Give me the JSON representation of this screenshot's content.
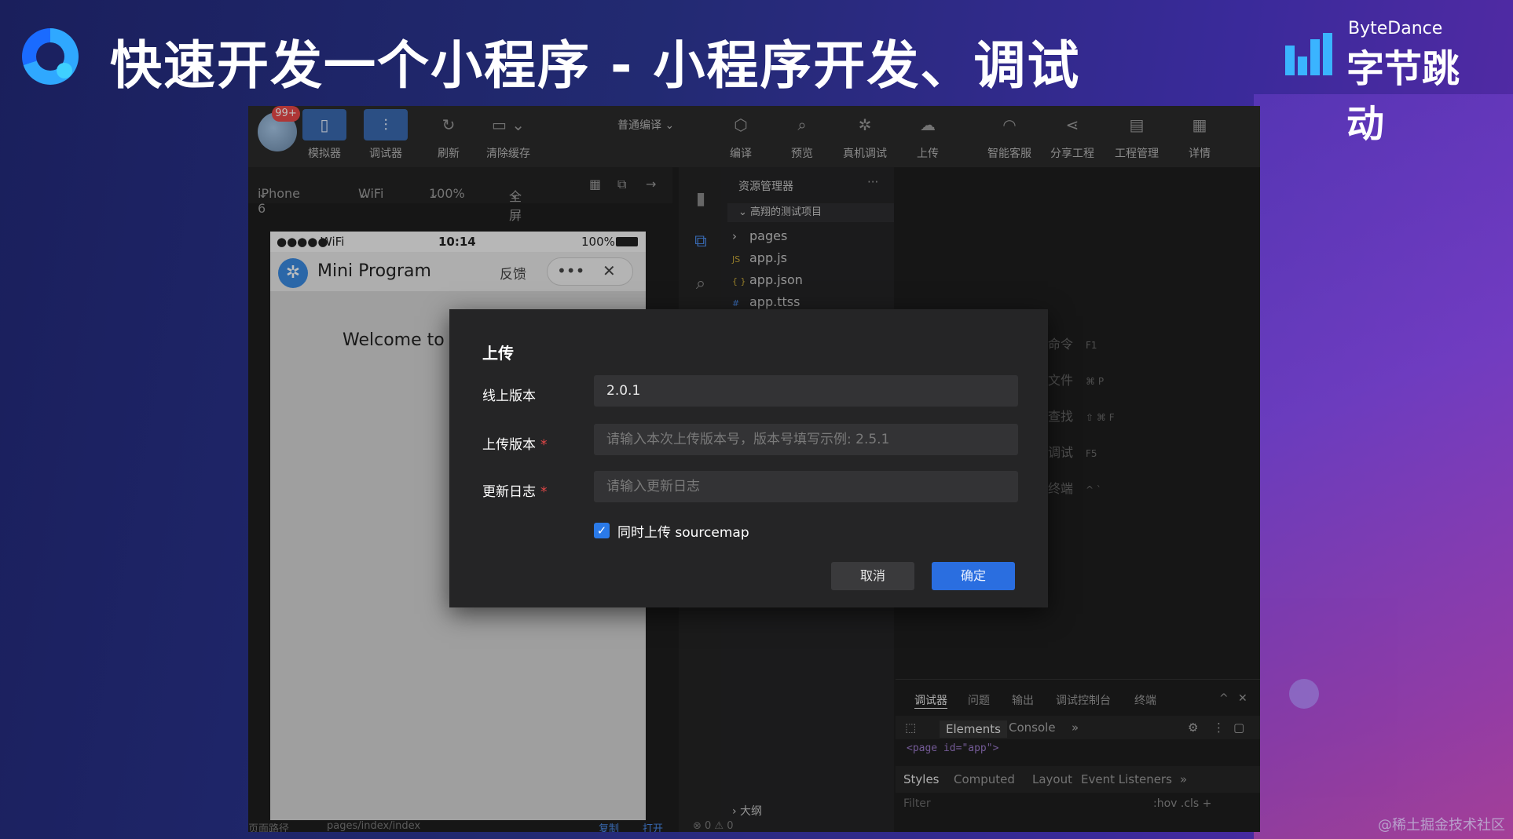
{
  "slide": {
    "title": "快速开发一个小程序 - 小程序开发、调试",
    "brand_en": "ByteDance",
    "brand_cn": "字节跳动",
    "watermark": "@稀土掘金技术社区"
  },
  "toolbar": {
    "badge": "99+",
    "simulator": "模拟器",
    "debugger": "调试器",
    "refresh": "刷新",
    "clear_cache": "清除缓存",
    "compile_mode": "普通编译",
    "compile": "编译",
    "preview": "预览",
    "device_debug": "真机调试",
    "upload": "上传",
    "support": "智能客服",
    "share": "分享工程",
    "project_mgmt": "工程管理",
    "details": "详情"
  },
  "devbar": {
    "device": "iPhone 6",
    "network": "WiFi",
    "zoom": "100%",
    "screen": "全屏"
  },
  "phone": {
    "signal": "●●●●●",
    "carrier": "WiFi",
    "time": "10:14",
    "battery": "100%",
    "app_title": "Mini Program",
    "feedback": "反馈",
    "more": "•••",
    "close": "✕",
    "welcome": "Welcome to"
  },
  "explorer": {
    "header": "资源管理器",
    "dots": "···",
    "project": "高翔的测试项目",
    "files": [
      {
        "icon": "›",
        "name": "pages"
      },
      {
        "icon": "JS",
        "name": "app.js"
      },
      {
        "icon": "{ }",
        "name": "app.json"
      },
      {
        "icon": "#",
        "name": "app.ttss"
      }
    ],
    "outline": "› 大纲"
  },
  "cmd_hints": [
    {
      "label": "命令",
      "keys": "F1"
    },
    {
      "label": "文件",
      "keys": "⌘  P"
    },
    {
      "label": "查找",
      "keys": "⇧  ⌘  F"
    },
    {
      "label": "调试",
      "keys": "F5"
    },
    {
      "label": "终端",
      "keys": "^  `"
    }
  ],
  "devtools": {
    "tabs": [
      "调试器",
      "问题",
      "输出",
      "调试控制台",
      "终端"
    ],
    "panel_tabs": [
      "Elements",
      "Console",
      "»"
    ],
    "code": "<page id=\"app\">",
    "style_tabs": [
      "Styles",
      "Computed",
      "Layout",
      "Event Listeners",
      "»"
    ],
    "filter": "Filter",
    "hov": ":hov  .cls  +"
  },
  "bottombar": {
    "path_label": "页面路径",
    "path": "pages/index/index",
    "copy": "复制",
    "open": "打开",
    "status": "⊗ 0 ⚠ 0"
  },
  "dialog": {
    "title": "上传",
    "online_version_label": "线上版本",
    "online_version_value": "2.0.1",
    "upload_version_label": "上传版本",
    "upload_version_placeholder": "请输入本次上传版本号，版本号填写示例: 2.5.1",
    "changelog_label": "更新日志",
    "changelog_placeholder": "请输入更新日志",
    "required_mark": "*",
    "sourcemap_label": "同时上传 sourcemap",
    "sourcemap_checked": true,
    "cancel": "取消",
    "confirm": "确定"
  }
}
